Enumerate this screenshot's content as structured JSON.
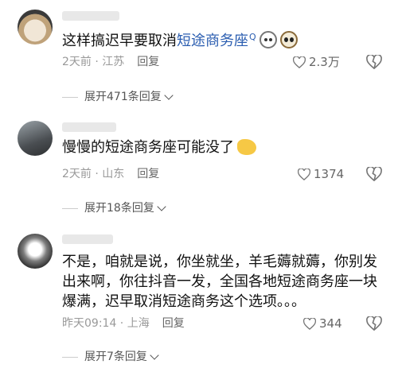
{
  "comments": [
    {
      "text_before": "这样搞迟早要取消",
      "highlight": "短途商务座",
      "search_mark": "Q",
      "meta": "2天前 · 江苏",
      "reply_label": "回复",
      "likes": "2.3万",
      "expand": "展开471条回复"
    },
    {
      "text_before": "慢慢的短途商务座可能没了",
      "meta": "2天前 · 山东",
      "reply_label": "回复",
      "likes": "1374",
      "expand": "展开18条回复"
    },
    {
      "line1": "不是，咱就是说，你坐就坐，羊毛薅就薅，你别发",
      "line2": "出来啊，你往抖音一发，全国各地短途商务座一块",
      "line3": "爆满，迟早取消短途商务这个选项。。。",
      "meta": "昨天09:14 · 上海",
      "reply_label": "回复",
      "likes": "344",
      "expand": "展开7条回复"
    }
  ]
}
